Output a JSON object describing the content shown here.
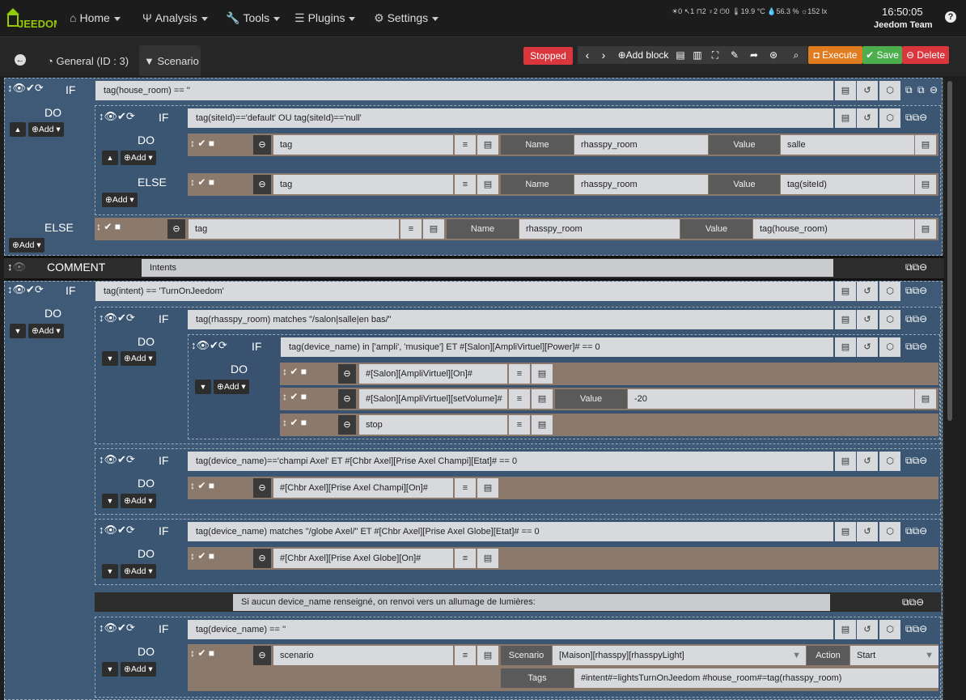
{
  "nav": {
    "logo": "JEEDOM",
    "items": [
      {
        "icon": "home-icon",
        "label": "Home"
      },
      {
        "icon": "analysis-icon",
        "label": "Analysis"
      },
      {
        "icon": "wrench-icon",
        "label": "Tools"
      },
      {
        "icon": "plugins-icon",
        "label": "Plugins"
      },
      {
        "icon": "gear-icon",
        "label": "Settings"
      }
    ],
    "widgets": {
      "w1": "0",
      "w2": "1",
      "w3": "2",
      "w4": "2",
      "w5": "0",
      "temp": "19.9 °C",
      "humidity": "56.3 %",
      "lux": "152 lx"
    },
    "time": "16:50:05",
    "user": "Jeedom Team",
    "help": "?"
  },
  "tabs": {
    "general": "General (ID : 3)",
    "scenario": "Scenario"
  },
  "toolbar": {
    "status": "Stopped",
    "add_block": "Add block",
    "execute": "Execute",
    "save": "Save",
    "delete": "Delete"
  },
  "keywords": {
    "if": "IF",
    "do": "DO",
    "else": "ELSE",
    "comment": "COMMENT",
    "add": "Add",
    "name": "Name",
    "value": "Value",
    "scenario": "Scenario",
    "action": "Action",
    "tags": "Tags"
  },
  "blocks": {
    "b1_cond": "tag(house_room) == ''",
    "b1_inner_cond": "tag(siteId)=='default' OU tag(siteId)=='null'",
    "b1_do_cmd": "tag",
    "b1_do_name": "rhasspy_room",
    "b1_do_value": "salle",
    "b1_else_cmd": "tag",
    "b1_else_name": "rhasspy_room",
    "b1_else_value": "tag(siteId)",
    "b1_outer_else_cmd": "tag",
    "b1_outer_else_name": "rhasspy_room",
    "b1_outer_else_value": "tag(house_room)",
    "comment": "Intents",
    "b2_cond": "tag(intent) == 'TurnOnJeedom'",
    "b2a_cond": "tag(rhasspy_room) matches \"/salon|salle|en bas/\"",
    "b2a1_cond": "tag(device_name) in ['ampli', 'musique'] ET #[Salon][AmpliVirtuel][Power]# == 0",
    "b2a1_a1": "#[Salon][AmpliVirtuel][On]#",
    "b2a1_a2": "#[Salon][AmpliVirtuel][setVolume]#",
    "b2a1_a2_value": "-20",
    "b2a1_a3": "stop",
    "b2b_cond": "tag(device_name)=='champi Axel' ET #[Chbr Axel][Prise Axel Champi][Etat]# == 0",
    "b2b_a1": "#[Chbr Axel][Prise Axel Champi][On]#",
    "b2c_cond": "tag(device_name) matches \"/globe Axel/\" ET #[Chbr Axel][Prise Axel Globe][Etat]# == 0",
    "b2c_a1": "#[Chbr Axel][Prise Axel Globe][On]#",
    "b2_note": "Si aucun device_name renseigné, on renvoi vers un allumage de lumières:",
    "b2d_cond": "tag(device_name) == ''",
    "b2d_a1": "scenario",
    "b2d_scenario": "[Maison][rhasspy][rhasspyLight]",
    "b2d_action": "Start",
    "b2d_tags": "#intent#=lightsTurnOnJeedom #house_room#=tag(rhasspy_room)"
  },
  "colors": {
    "accent_stop": "#d9363e",
    "execute": "#e07b1f",
    "save": "#4cae4c",
    "delete": "#d9363e",
    "block_blue": "#3e5a76",
    "action_brown": "#8b7a6c"
  }
}
